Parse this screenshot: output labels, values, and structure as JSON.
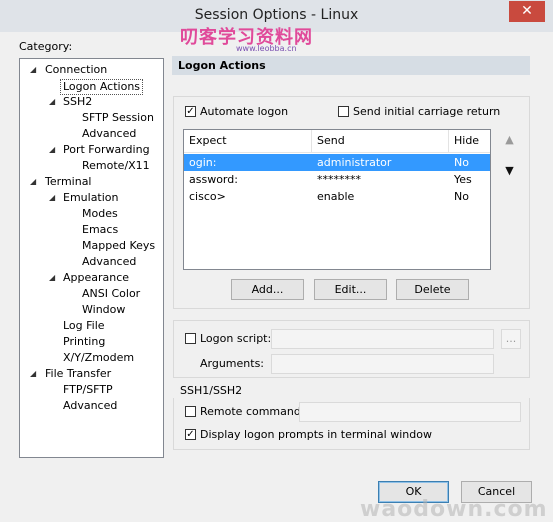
{
  "window": {
    "title": "Session Options - Linux",
    "close_glyph": "✕",
    "watermark_top": "叨客学习资料网",
    "watermark_url": "www.leobba.cn",
    "watermark_bottom": "waodown.com"
  },
  "category_label": "Category:",
  "tree": [
    {
      "label": "Connection",
      "twisty": "◢"
    },
    {
      "label": "Logon Actions",
      "twisty": ""
    },
    {
      "label": "SSH2",
      "twisty": "◢"
    },
    {
      "label": "SFTP Session",
      "twisty": ""
    },
    {
      "label": "Advanced",
      "twisty": ""
    },
    {
      "label": "Port Forwarding",
      "twisty": "◢"
    },
    {
      "label": "Remote/X11",
      "twisty": ""
    },
    {
      "label": "Terminal",
      "twisty": "◢"
    },
    {
      "label": "Emulation",
      "twisty": "◢"
    },
    {
      "label": "Modes",
      "twisty": ""
    },
    {
      "label": "Emacs",
      "twisty": ""
    },
    {
      "label": "Mapped Keys",
      "twisty": ""
    },
    {
      "label": "Advanced",
      "twisty": ""
    },
    {
      "label": "Appearance",
      "twisty": "◢"
    },
    {
      "label": "ANSI Color",
      "twisty": ""
    },
    {
      "label": "Window",
      "twisty": ""
    },
    {
      "label": "Log File",
      "twisty": ""
    },
    {
      "label": "Printing",
      "twisty": ""
    },
    {
      "label": "X/Y/Zmodem",
      "twisty": ""
    },
    {
      "label": "File Transfer",
      "twisty": "◢"
    },
    {
      "label": "FTP/SFTP",
      "twisty": ""
    },
    {
      "label": "Advanced",
      "twisty": ""
    }
  ],
  "section_title": "Logon Actions",
  "automate_logon": {
    "label": "Automate logon",
    "checked": true,
    "mark": "✓"
  },
  "send_cr": {
    "label": "Send initial carriage return",
    "checked": false
  },
  "table": {
    "headers": [
      "Expect",
      "Send",
      "Hide"
    ],
    "rows": [
      {
        "expect": "ogin:",
        "send": "administrator",
        "hide": "No",
        "selected": true
      },
      {
        "expect": "assword:",
        "send": "********",
        "hide": "Yes",
        "selected": false
      },
      {
        "expect": "cisco>",
        "send": "enable",
        "hide": "No",
        "selected": false
      }
    ]
  },
  "move_up_glyph": "▲",
  "move_down_glyph": "▼",
  "buttons": {
    "add": "Add...",
    "edit": "Edit...",
    "delete": "Delete"
  },
  "logon_script": {
    "label": "Logon script:",
    "value": "",
    "browse": "...",
    "checked": false
  },
  "arguments": {
    "label": "Arguments:",
    "value": ""
  },
  "ssh_group_label": "SSH1/SSH2",
  "remote_command": {
    "label": "Remote command:",
    "value": "",
    "checked": false
  },
  "display_prompts": {
    "label": "Display logon prompts in terminal window",
    "checked": true,
    "mark": "✓"
  },
  "footer": {
    "ok": "OK",
    "cancel": "Cancel"
  }
}
